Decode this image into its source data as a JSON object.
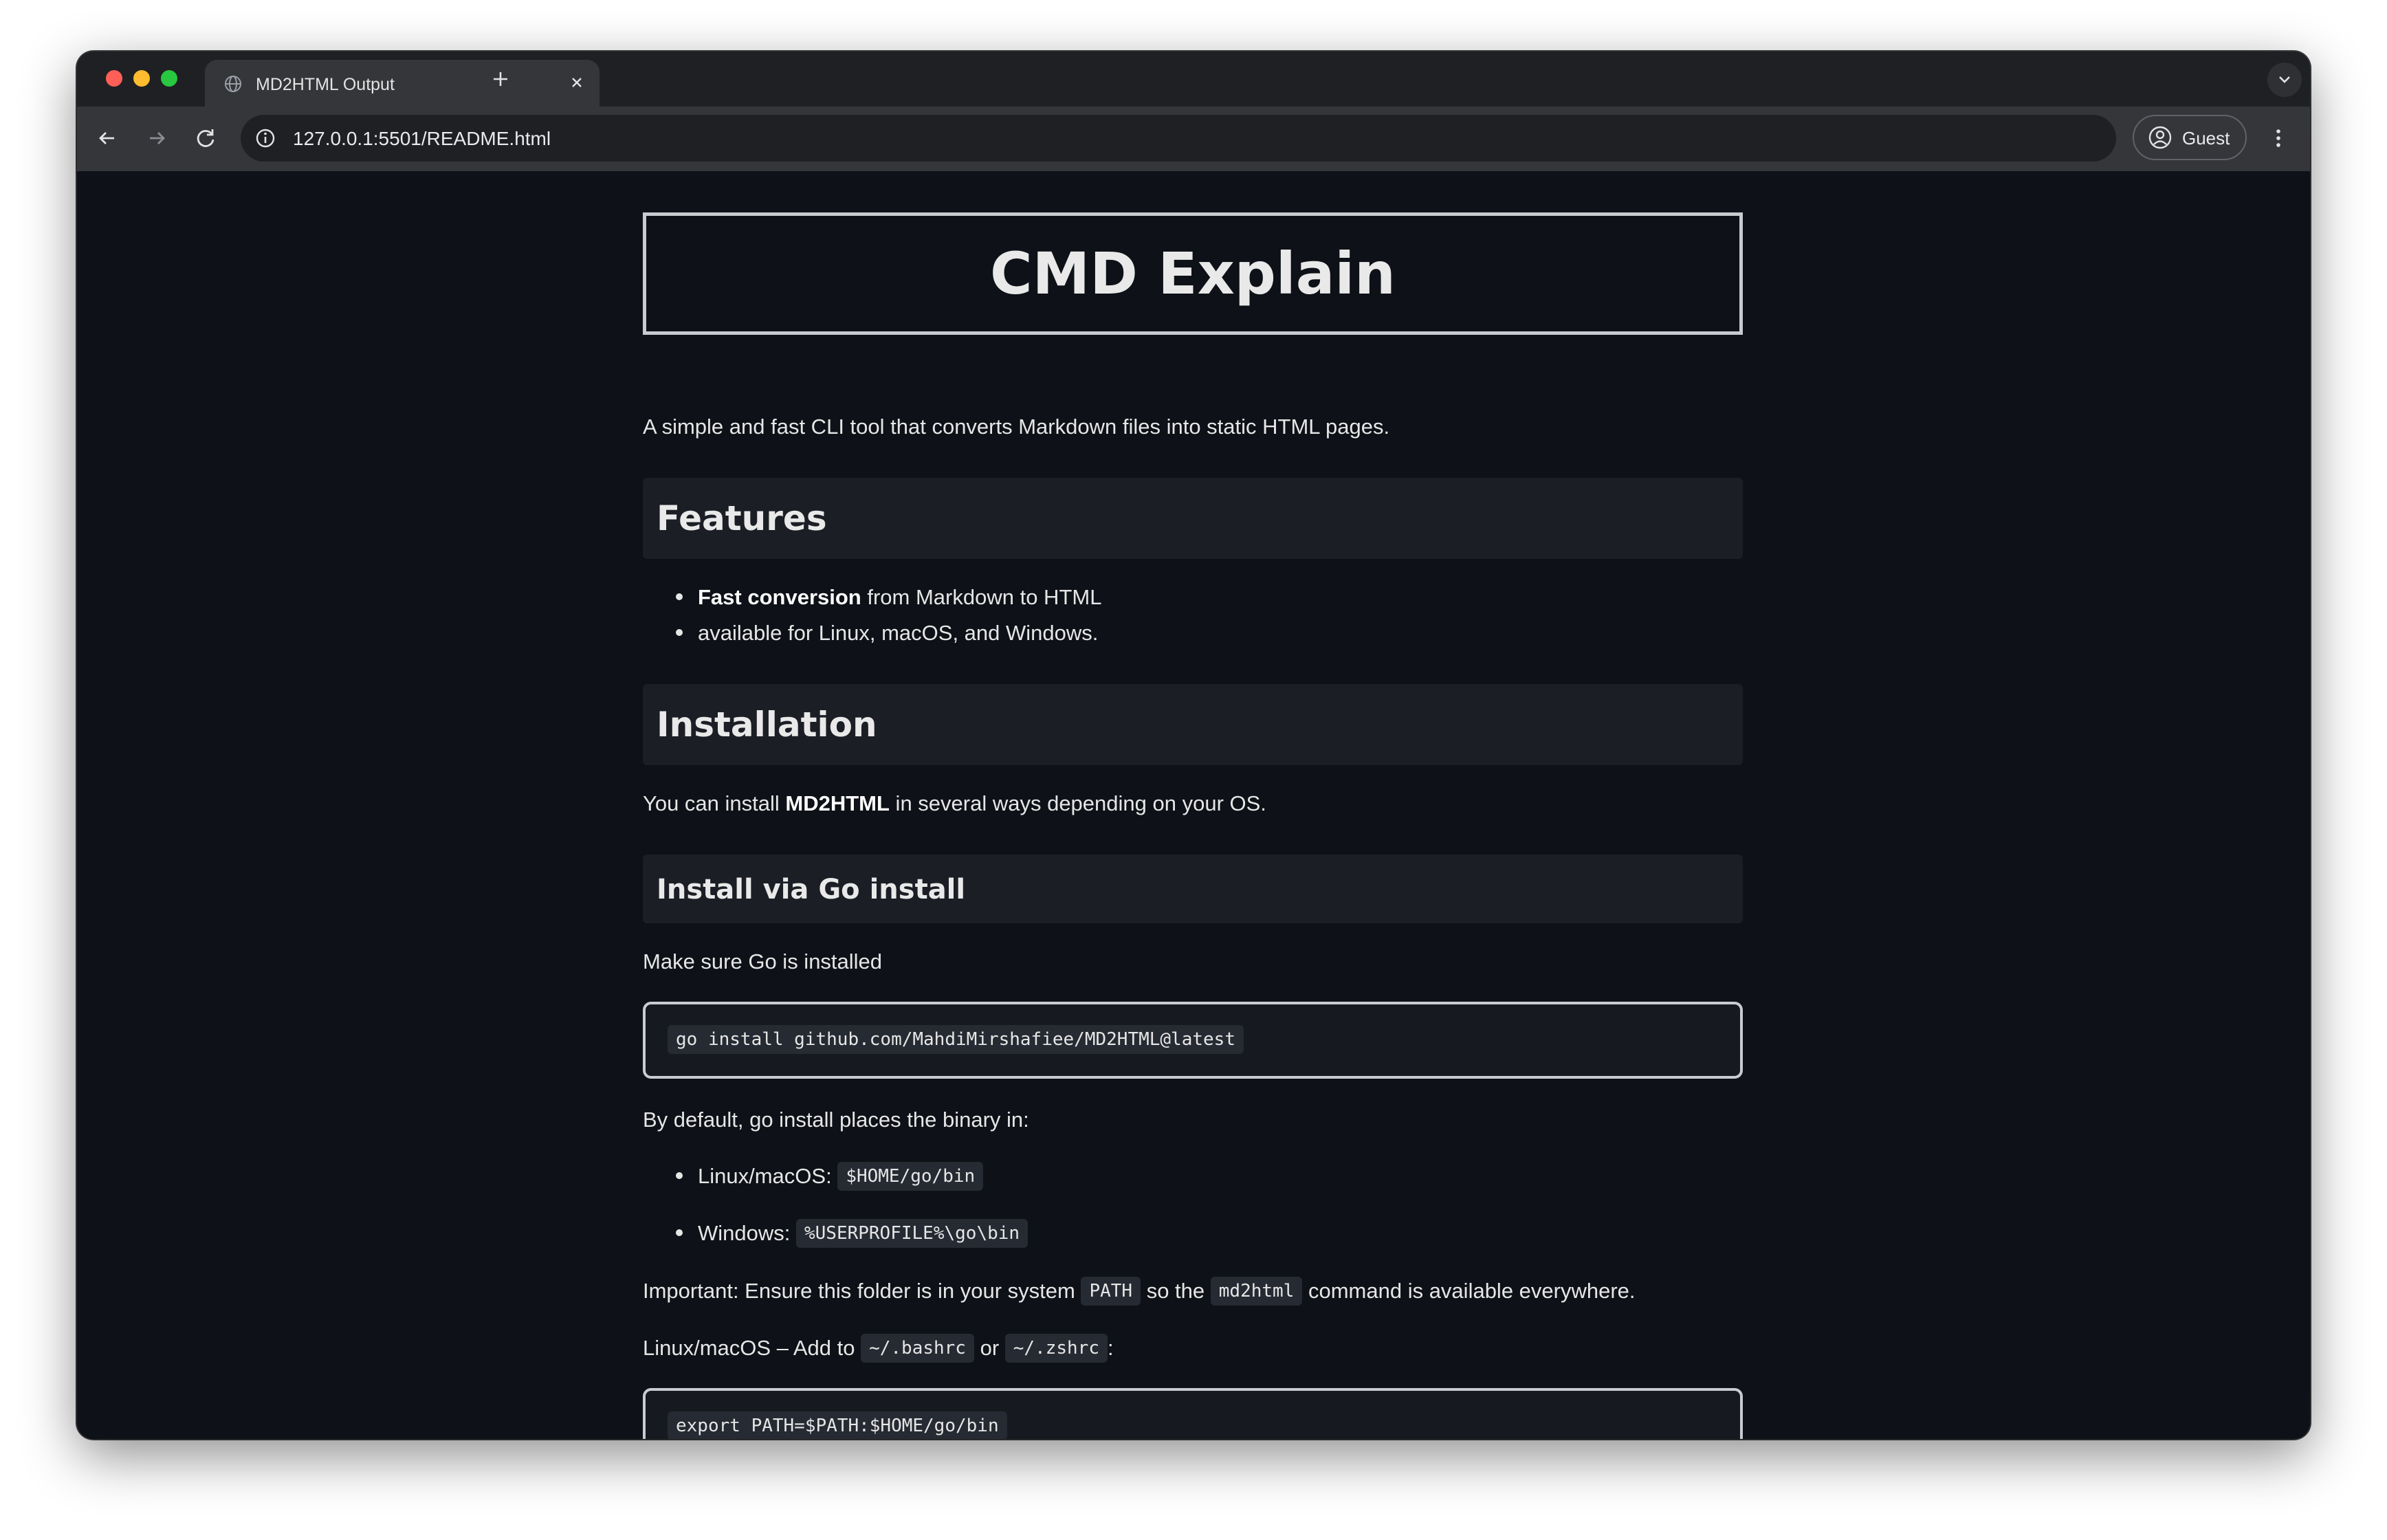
{
  "browser": {
    "tab": {
      "title": "MD2HTML Output"
    },
    "address_bar": {
      "url": "127.0.0.1:5501/README.html"
    },
    "profile": {
      "label": "Guest"
    },
    "icons": {
      "tab_favicon": "globe-icon",
      "tab_close": "close-icon",
      "new_tab": "plus-icon",
      "tab_search": "chevron-down-icon",
      "back": "arrow-left-icon",
      "forward": "arrow-right-icon",
      "reload": "reload-icon",
      "site_info": "info-icon",
      "profile": "person-circle-icon",
      "menu": "kebab-menu-icon"
    },
    "colors": {
      "close": "#ff5f57",
      "minimize": "#febc2e",
      "maximize": "#28c840"
    }
  },
  "document": {
    "title": "CMD Explain",
    "intro": "A simple and fast CLI tool that converts Markdown files into static HTML pages.",
    "features": {
      "heading": "Features",
      "items": [
        {
          "bold": "Fast conversion",
          "text": " from Markdown to HTML"
        },
        {
          "bold": "",
          "text": "available for Linux, macOS, and Windows."
        }
      ]
    },
    "installation": {
      "heading": "Installation",
      "intro_before": "You can install ",
      "intro_bold": "MD2HTML",
      "intro_after": " in several ways depending on your OS."
    },
    "go_install": {
      "heading": "Install via Go install",
      "prereq": "Make sure Go is installed",
      "command": "go install github.com/MahdiMirshafiee/MD2HTML@latest",
      "default_note": "By default, go install places the binary in:",
      "locations": [
        {
          "label": "Linux/macOS: ",
          "path": "$HOME/go/bin"
        },
        {
          "label": "Windows: ",
          "path": "%USERPROFILE%\\go\\bin"
        }
      ],
      "important": {
        "before": "Important: Ensure this folder is in your system ",
        "code1": "PATH",
        "middle": " so the ",
        "code2": "md2html",
        "after": " command is available everywhere."
      },
      "shell_note": {
        "before": "Linux/macOS – Add to ",
        "code1": "~/.bashrc",
        "middle": " or ",
        "code2": "~/.zshrc",
        "after": ":"
      },
      "export_command": "export PATH=$PATH:$HOME/go/bin"
    }
  }
}
